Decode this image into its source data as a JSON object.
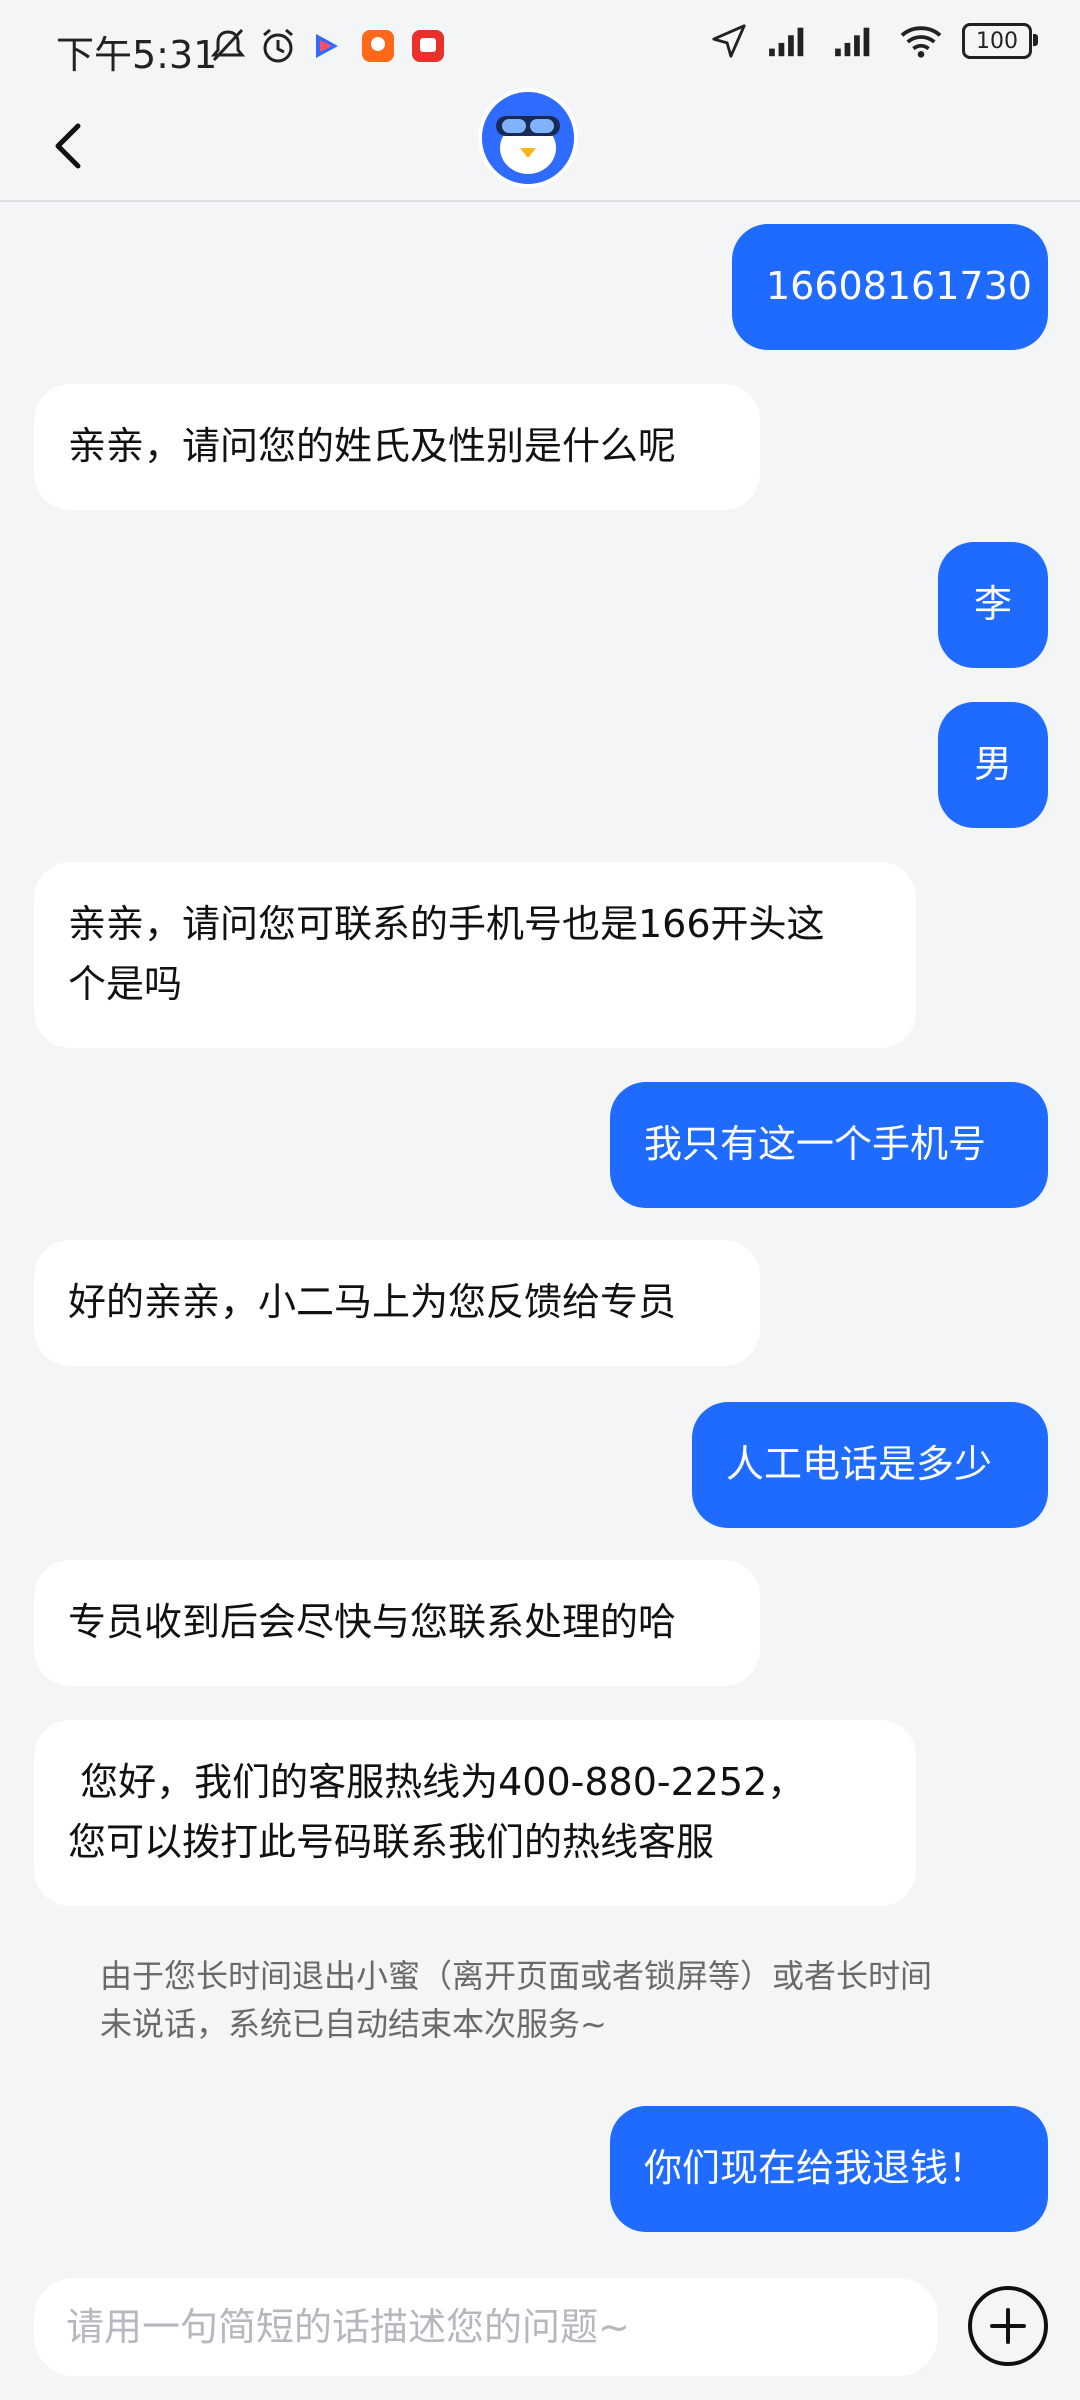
{
  "status_bar": {
    "time": "下午5:31",
    "battery": "100"
  },
  "header": {
    "back_icon": "chevron-left-icon",
    "avatar_icon": "penguin-avatar"
  },
  "messages": [
    {
      "from": "me",
      "text": "16608161730"
    },
    {
      "from": "bot",
      "text": "亲亲，请问您的姓氏及性别是什么呢"
    },
    {
      "from": "me",
      "text": "李"
    },
    {
      "from": "me",
      "text": "男"
    },
    {
      "from": "bot",
      "text": "亲亲，请问您可联系的手机号也是166开头这\n个是吗"
    },
    {
      "from": "me",
      "text": "我只有这一个手机号"
    },
    {
      "from": "bot",
      "text": "好的亲亲，小二马上为您反馈给专员"
    },
    {
      "from": "me",
      "text": "人工电话是多少"
    },
    {
      "from": "bot",
      "text": "专员收到后会尽快与您联系处理的哈"
    },
    {
      "from": "bot",
      "text": " 您好，我们的客服热线为400-880-2252，\n您可以拨打此号码联系我们的热线客服"
    },
    {
      "from": "me",
      "text": "你们现在给我退钱！"
    }
  ],
  "system_note": "由于您长时间退出小蜜（离开页面或者锁屏等）或者长时间\n未说话，系统已自动结束本次服务~",
  "input": {
    "placeholder": "请用一句简短的话描述您的问题~",
    "add_icon": "plus-circle-icon"
  },
  "colors": {
    "accent": "#1f6bff",
    "background": "#f4f5f7"
  }
}
